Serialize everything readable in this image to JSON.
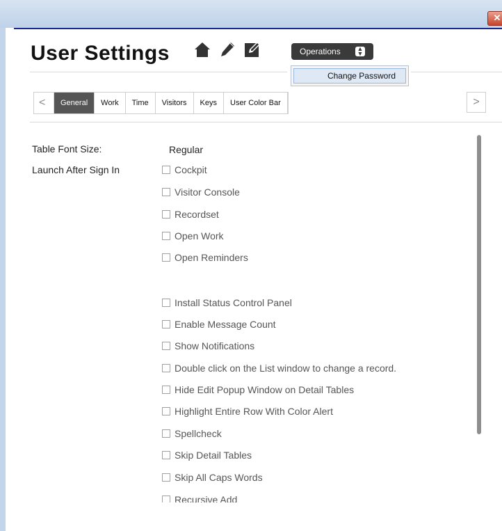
{
  "window": {
    "close_glyph": "✕"
  },
  "page": {
    "title": "User Settings"
  },
  "title_icons": [
    "home-icon",
    "pencil-icon",
    "edit-box-icon"
  ],
  "operations": {
    "label": "Operations",
    "menu_item": "Change Password"
  },
  "tabs": {
    "prev_glyph": "<",
    "next_glyph": ">",
    "items": [
      "General",
      "Work",
      "Time",
      "Visitors",
      "Keys",
      "User Color Bar"
    ],
    "active": "General"
  },
  "settings": {
    "table_font_size_label": "Table Font Size:",
    "table_font_size_value": "Regular",
    "launch_label": "Launch After Sign In",
    "launch_options": [
      "Cockpit",
      "Visitor Console",
      "Recordset",
      "Open Work",
      "Open Reminders"
    ],
    "options": [
      "Install Status Control Panel",
      "Enable Message Count",
      "Show Notifications",
      "Double click on the List window to change a record.",
      "Hide Edit Popup Window on Detail Tables",
      "Highlight Entire Row With Color Alert",
      "Spellcheck",
      "Skip Detail Tables",
      "Skip All Caps Words",
      "Recursive Add"
    ]
  },
  "colors": {
    "accent": "#1b2a8e",
    "active_tab": "#555555",
    "operations_button": "#3a3a3a"
  }
}
